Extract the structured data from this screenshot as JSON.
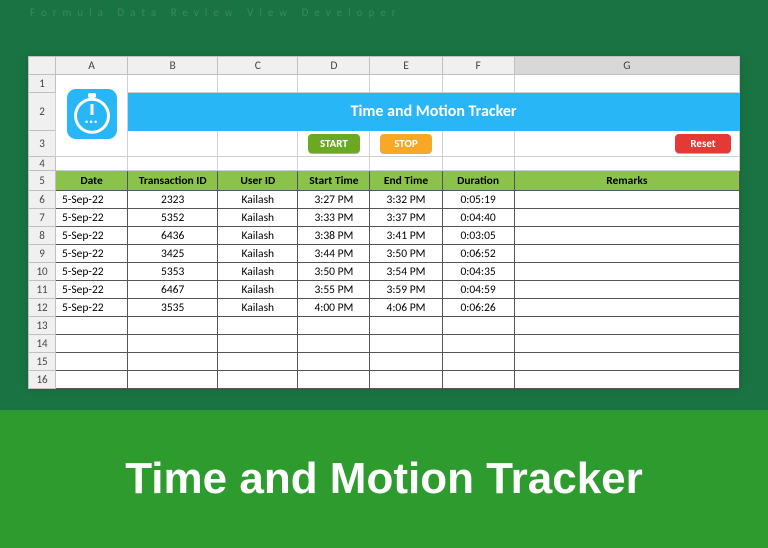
{
  "columns": [
    "",
    "A",
    "B",
    "C",
    "D",
    "E",
    "F",
    "G"
  ],
  "title": "Time and Motion Tracker",
  "buttons": {
    "start": "START",
    "stop": "STOP",
    "reset": "Reset"
  },
  "headers": {
    "date": "Date",
    "txid": "Transaction ID",
    "user": "User ID",
    "stime": "Start Time",
    "etime": "End Time",
    "dur": "Duration",
    "remarks": "Remarks"
  },
  "rows": [
    {
      "date": "5-Sep-22",
      "txid": "2323",
      "user": "Kailash",
      "stime": "3:27 PM",
      "etime": "3:32 PM",
      "dur": "0:05:19",
      "remarks": ""
    },
    {
      "date": "5-Sep-22",
      "txid": "5352",
      "user": "Kailash",
      "stime": "3:33 PM",
      "etime": "3:37 PM",
      "dur": "0:04:40",
      "remarks": ""
    },
    {
      "date": "5-Sep-22",
      "txid": "6436",
      "user": "Kailash",
      "stime": "3:38 PM",
      "etime": "3:41 PM",
      "dur": "0:03:05",
      "remarks": ""
    },
    {
      "date": "5-Sep-22",
      "txid": "3425",
      "user": "Kailash",
      "stime": "3:44 PM",
      "etime": "3:50 PM",
      "dur": "0:06:52",
      "remarks": ""
    },
    {
      "date": "5-Sep-22",
      "txid": "5353",
      "user": "Kailash",
      "stime": "3:50 PM",
      "etime": "3:54 PM",
      "dur": "0:04:35",
      "remarks": ""
    },
    {
      "date": "5-Sep-22",
      "txid": "6467",
      "user": "Kailash",
      "stime": "3:55 PM",
      "etime": "3:59 PM",
      "dur": "0:04:59",
      "remarks": ""
    },
    {
      "date": "5-Sep-22",
      "txid": "3535",
      "user": "Kailash",
      "stime": "4:00 PM",
      "etime": "4:06 PM",
      "dur": "0:06:26",
      "remarks": ""
    }
  ],
  "emptyRows": 4,
  "footer": "Time and Motion Tracker"
}
